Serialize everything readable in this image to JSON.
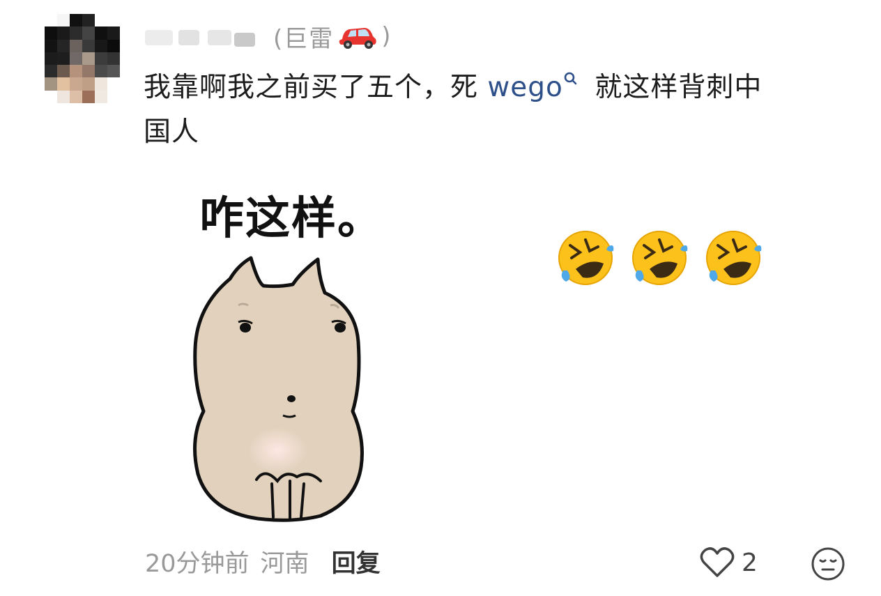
{
  "comment": {
    "user_tag": "(巨雷",
    "user_tag_close": ")",
    "text_before_link": "我靠啊我之前买了五个，死 ",
    "link_text": "wego",
    "text_after_link_line1": " 就这样背刺中",
    "text_line2": "国人",
    "sticker_caption": "咋这样。",
    "emojis": [
      "rolling-on-floor-laughing",
      "rolling-on-floor-laughing",
      "rolling-on-floor-laughing"
    ],
    "time": "20分钟前",
    "location": "河南",
    "reply_label": "回复",
    "like_count": "2"
  },
  "colors": {
    "link": "#2d4f8a",
    "meta_text": "#999999",
    "sticker_body": "#e2d2bd"
  },
  "icons": [
    "car-icon",
    "search-icon",
    "heart-icon",
    "face-icon"
  ]
}
